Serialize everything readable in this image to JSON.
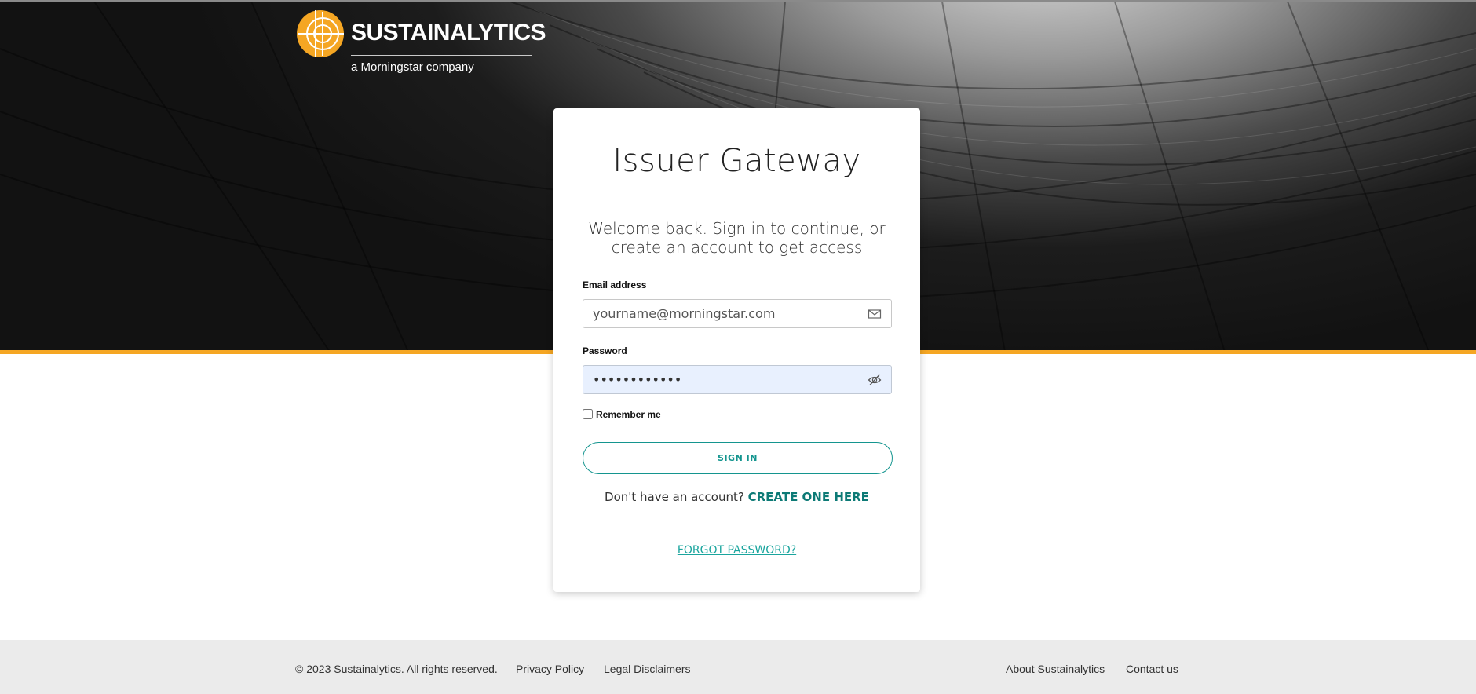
{
  "brand": {
    "name": "SUSTAINALYTICS",
    "tagline": "a Morningstar company",
    "logo_color": "#f5a623"
  },
  "card": {
    "title": "Issuer Gateway",
    "subtitle": "Welcome back. Sign in to continue, or create an account to get access"
  },
  "form": {
    "email_label": "Email address",
    "email_placeholder": "yourname@morningstar.com",
    "email_icon": "envelope-icon",
    "password_label": "Password",
    "password_value": "••••••••••••",
    "password_icon": "eye-slash-icon",
    "remember_label": "Remember me",
    "remember_checked": false,
    "signin_label": "SIGN IN",
    "no_account_text": "Don't have an account?",
    "create_link": "CREATE ONE HERE",
    "forgot_link": "FORGOT PASSWORD?"
  },
  "footer": {
    "copyright": "© 2023 Sustainalytics. All rights reserved.",
    "privacy": "Privacy Policy",
    "legal": "Legal Disclaimers",
    "about": "About Sustainalytics",
    "contact": "Contact us"
  },
  "colors": {
    "accent": "#14958f",
    "stripe": "#f5a623",
    "footer_bg": "#ebebeb"
  }
}
